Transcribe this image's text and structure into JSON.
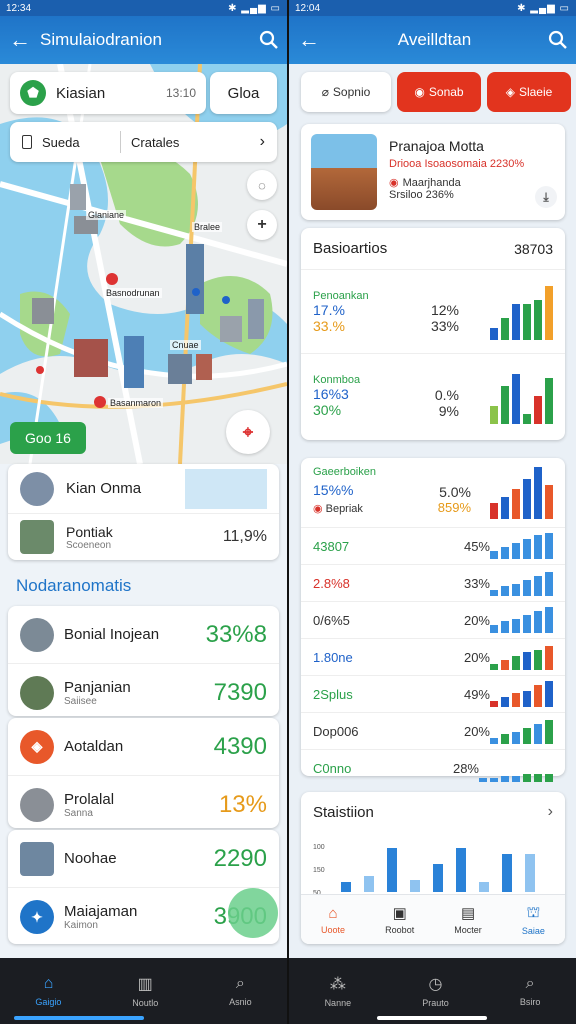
{
  "left": {
    "status_time": "12:34",
    "title": "Simulaiodranion",
    "search_chip": {
      "label": "Kiasian",
      "value": "13:10",
      "button": "Gloa"
    },
    "filter": {
      "left": "Sueda",
      "right": "Cratales"
    },
    "map_labels": {
      "a": "Glaniane",
      "b": "Basnodrunan",
      "c": "Bralee",
      "d": "Cnuae",
      "e": "Basanmaron"
    },
    "go_button": "Goo 16",
    "places": [
      {
        "name": "Kian Onma",
        "sub": "",
        "val": ""
      },
      {
        "name": "Pontiak",
        "sub": "Scoeneon",
        "val": "11,9%"
      }
    ],
    "section": "Nodaranomatis",
    "list": [
      {
        "name": "Bonial Inojean",
        "sub": "",
        "val": "33%8",
        "color": "#2ba14a"
      },
      {
        "name": "Panjanian",
        "sub": "Saiisee",
        "val": "7390",
        "color": "#2ba14a"
      },
      {
        "name": "Aotaldan",
        "sub": "",
        "val": "4390",
        "color": "#2ba14a"
      },
      {
        "name": "Prolalal",
        "sub": "Sanna",
        "val": "13%",
        "color": "#e69a1a"
      },
      {
        "name": "Noohae",
        "sub": "",
        "val": "2290",
        "color": "#2ba14a"
      },
      {
        "name": "Maiajaman",
        "sub": "Kaimon",
        "val": "3900",
        "color": "#2ba14a"
      }
    ],
    "tabs": [
      "Gaigio",
      "Noutlo",
      "Asnio"
    ]
  },
  "right": {
    "status_time": "12:04",
    "title": "Aveilldtan",
    "buttons": [
      "Sopnio",
      "Sonab",
      "Slaeie"
    ],
    "poi": {
      "title": "Pranajoa Motta",
      "sub1": "Driooa Isoaosomaia 2230%",
      "sub2": "Maarjhanda",
      "sub3": "Srsiloo 236%"
    },
    "stats1": {
      "title": "Basioartios",
      "value": "38703",
      "rows": [
        {
          "l1": "Penoankan",
          "l2": "17.%",
          "l3": "33.%",
          "r1": "12%",
          "r2": "33%"
        },
        {
          "l1": "Konmboa",
          "l2": "16%3",
          "l3": "30%",
          "r1": "0.%",
          "r2": "9%"
        }
      ]
    },
    "stats2": {
      "head": "Gaeerboiken",
      "rows": [
        {
          "a": "15%%",
          "b": "5.0%",
          "sub": "",
          "lab": "Bepriak",
          "sb": "859%"
        },
        {
          "a": "43807",
          "b": "45%"
        },
        {
          "a": "2.8%8",
          "b": "33%"
        },
        {
          "a": "0/6%5",
          "b": "20%"
        },
        {
          "a": "1.80ne",
          "b": "20%"
        },
        {
          "a": "2Splus",
          "b": "49%"
        },
        {
          "a": "Dop006",
          "b": "20%"
        },
        {
          "a": "C0nno",
          "b": "28%"
        }
      ]
    },
    "stats3": {
      "title": "Staistiion",
      "ticks": [
        "100",
        "150",
        "50"
      ]
    },
    "mini_tabs": [
      "Uoote",
      "Roobot",
      "Mocter",
      "Saiae"
    ],
    "tabs": [
      "Nanne",
      "Prauto",
      "Bsiro"
    ]
  }
}
